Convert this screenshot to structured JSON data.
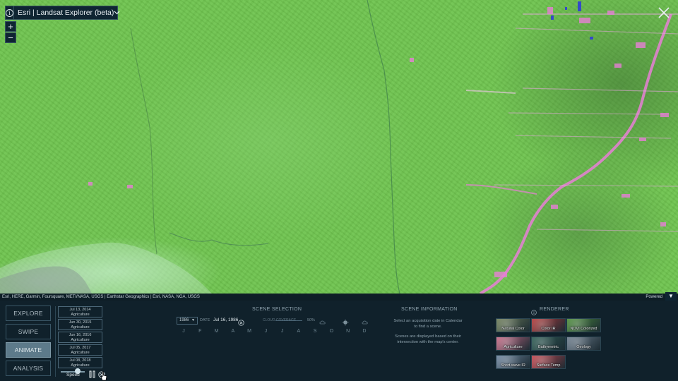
{
  "header": {
    "title": "Esri | Landsat Explorer (beta)",
    "info_icon": "info-icon",
    "menu_icon": "chevron-down-icon"
  },
  "zoom": {
    "in_label": "+",
    "out_label": "−"
  },
  "close_icon": "close-icon",
  "attribution": {
    "text": "Esri, HERE, Garmin, Foursquare, METI/NASA, USGS | Earthstar Geographics | Esri, NASA, NGA, USGS",
    "powered": "Powered",
    "collapse_label": "▼"
  },
  "modes": [
    {
      "label": "EXPLORE",
      "active": false
    },
    {
      "label": "SWIPE",
      "active": false
    },
    {
      "label": "ANIMATE",
      "active": true
    },
    {
      "label": "ANALYSIS",
      "active": false
    }
  ],
  "animation_scenes": [
    {
      "date": "Jul 13, 2014",
      "renderer": "Agriculture"
    },
    {
      "date": "Jun 30, 2015",
      "renderer": "Agriculture"
    },
    {
      "date": "Jun 16, 2016",
      "renderer": "Agriculture"
    },
    {
      "date": "Jul 05, 2017",
      "renderer": "Agriculture"
    },
    {
      "date": "Jul 08, 2018",
      "renderer": "Agriculture"
    }
  ],
  "animation_controls": {
    "speed_label": "Speed",
    "speed_level": 0.7
  },
  "scene_selection": {
    "title": "SCENE SELECTION",
    "year": "1986",
    "date_label": "DATE",
    "date_value": "Jul 16, 1986",
    "cloud_label": "CLOUD COVERAGE",
    "cloud_value": "50%",
    "months": [
      "J",
      "F",
      "M",
      "A",
      "M",
      "J",
      "J",
      "A",
      "S",
      "O",
      "N",
      "D"
    ]
  },
  "scene_information": {
    "title": "SCENE INFORMATION",
    "line1": "Select an acquisition date in Calendar",
    "line2": "to find a scene.",
    "line3": "Scenes are displayed based on their",
    "line4": "intersection with the map's center."
  },
  "renderer": {
    "title": "RENDERER",
    "items": [
      {
        "label": "Natural Color",
        "color": "#6f7f5a"
      },
      {
        "label": "Color IR",
        "color": "#b33a3a"
      },
      {
        "label": "NDVI Colorized",
        "color": "#4e8f3c"
      },
      {
        "label": "Agriculture",
        "color": "#c86a86"
      },
      {
        "label": "Bathymetric",
        "color": "#2f5d54"
      },
      {
        "label": "Geology",
        "color": "#6f7f8f"
      },
      {
        "label": "Short-wave IR",
        "color": "#6f86a0"
      },
      {
        "label": "Surface Temp",
        "color": "#c4464f"
      }
    ]
  },
  "colors": {
    "map_vegetation": "#6fc44f",
    "clearing_pink": "#e77fd6",
    "panel_bg": "#10212b",
    "active_mode": "#5d7a8a"
  }
}
